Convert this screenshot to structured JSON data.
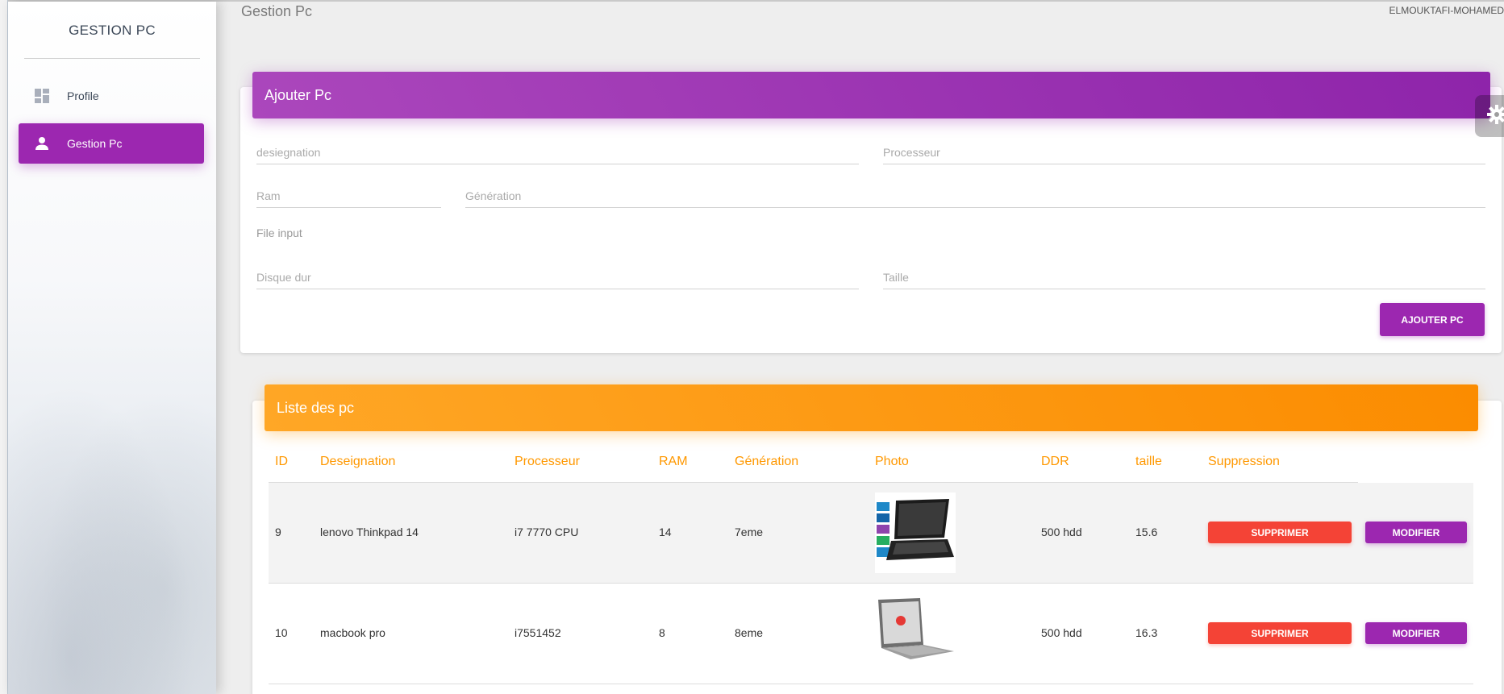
{
  "sidebar": {
    "brand": "GESTION PC",
    "items": [
      {
        "label": "Profile",
        "icon": "dashboard-icon",
        "active": false
      },
      {
        "label": "Gestion Pc",
        "icon": "person-icon",
        "active": true
      }
    ]
  },
  "header": {
    "title": "Gestion Pc",
    "user": "ELMOUKTAFI-MOHAMED"
  },
  "add_form": {
    "title": "Ajouter Pc",
    "designation_placeholder": "desiegnation",
    "processeur_placeholder": "Processeur",
    "ram_placeholder": "Ram",
    "generation_placeholder": "Génération",
    "file_label": "File input",
    "disque_placeholder": "Disque dur",
    "taille_placeholder": "Taille",
    "submit_label": "AJOUTER PC"
  },
  "list": {
    "title": "Liste des pc",
    "columns": [
      "ID",
      "Deseignation",
      "Processeur",
      "RAM",
      "Génération",
      "Photo",
      "DDR",
      "taille",
      "Suppression"
    ],
    "rows": [
      {
        "id": "9",
        "designation": "lenovo Thinkpad 14",
        "processeur": "i7 7770 CPU",
        "ram": "14",
        "generation": "7eme",
        "photo": "laptop-thinkpad-photo",
        "ddr": "500 hdd",
        "taille": "15.6",
        "delete_label": "SUPPRIMER",
        "edit_label": "MODIFIER"
      },
      {
        "id": "10",
        "designation": "macbook pro",
        "processeur": "i7551452",
        "ram": "8",
        "generation": "8eme",
        "photo": "laptop-silver-photo",
        "ddr": "500 hdd",
        "taille": "16.3",
        "delete_label": "SUPPRIMER",
        "edit_label": "MODIFIER"
      }
    ]
  },
  "colors": {
    "primary_purple": "#9c27b0",
    "header_orange": "#ff9800",
    "danger_red": "#f44336",
    "background": "#eeeeee"
  }
}
